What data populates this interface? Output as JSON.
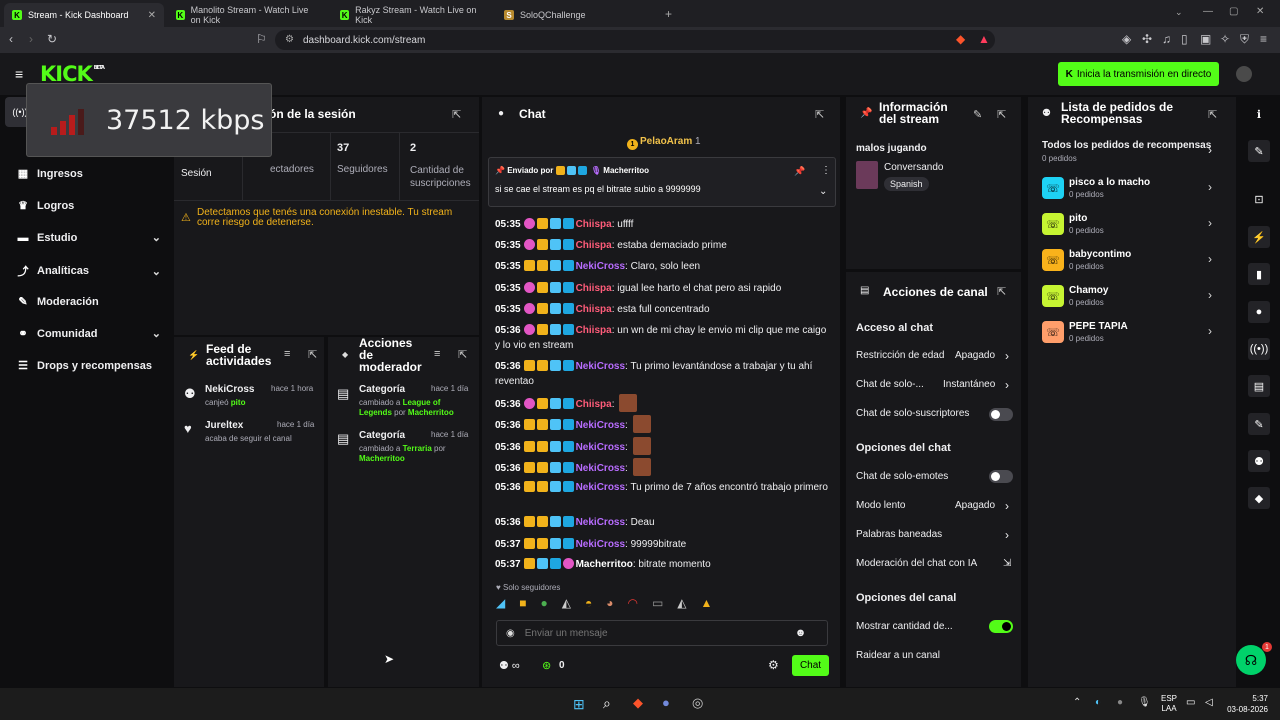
{
  "browser": {
    "tabs": [
      {
        "label": "Stream - Kick Dashboard",
        "active": true
      },
      {
        "label": "Manolito Stream - Watch Live on Kick",
        "active": false
      },
      {
        "label": "Rakyz Stream - Watch Live on Kick",
        "active": false
      },
      {
        "label": "SoloQChallenge",
        "active": false
      }
    ],
    "url": "dashboard.kick.com/stream"
  },
  "header": {
    "logo": "KICK",
    "logo_tag": "BETA",
    "go_live_label": "Inicia la transmisión en directo"
  },
  "overlay": {
    "kbps": "37512 kbps"
  },
  "sidebar": {
    "items": [
      {
        "label": "Ingresos",
        "icon": "dollar-icon",
        "chevron": false
      },
      {
        "label": "Logros",
        "icon": "trophy-icon",
        "chevron": false
      },
      {
        "label": "Estudio",
        "icon": "studio-icon",
        "chevron": true
      },
      {
        "label": "Analíticas",
        "icon": "chart-icon",
        "chevron": true
      },
      {
        "label": "Moderación",
        "icon": "wrench-icon",
        "chevron": false
      },
      {
        "label": "Comunidad",
        "icon": "community-icon",
        "chevron": true
      },
      {
        "label": "Drops y recompensas",
        "icon": "list-icon",
        "chevron": false
      }
    ]
  },
  "session": {
    "title": "ón de la sesión",
    "stats": [
      {
        "value": "",
        "label": "Sesión"
      },
      {
        "value": "",
        "label": "ectadores"
      },
      {
        "value": "37",
        "label": "Seguidores"
      },
      {
        "value": "2",
        "label": "Cantidad de suscripciones"
      }
    ],
    "warning": "Detectamos que tenés una conexión inestable. Tu stream corre riesgo de detenerse."
  },
  "activity_feed": {
    "title": "Feed de actividades",
    "items": [
      {
        "user": "NekiCross",
        "time": "hace 1 hora",
        "text_prefix": "canjeó ",
        "highlight": "pito"
      },
      {
        "user": "Jureltex",
        "time": "hace 1 día",
        "text_prefix": "acaba de seguir el canal",
        "highlight": ""
      }
    ]
  },
  "mod_actions": {
    "title": "Acciones de moderador",
    "items": [
      {
        "title": "Categoría",
        "time": "hace 1 día",
        "prefix": "cambiado a ",
        "value": "League of Legends",
        "by_label": " por ",
        "by": "Macherritoo"
      },
      {
        "title": "Categoría",
        "time": "hace 1 día",
        "prefix": "cambiado a ",
        "value": "Terraria",
        "by_label": " por ",
        "by": "Macherritoo"
      }
    ]
  },
  "chat": {
    "title": "Chat",
    "top_gifter": "PelaoAram",
    "top_gifter_count": "1",
    "pinned_by_label": "Enviado por",
    "pinned_by": "Macherritoo",
    "pinned_text": "si se cae el stream es pq el bitrate subio a 9999999",
    "messages": [
      {
        "time": "05:35",
        "user": "Chiispa",
        "color": "red",
        "text": "uffff"
      },
      {
        "time": "05:35",
        "user": "Chiispa",
        "color": "red",
        "text": "estaba demaciado prime"
      },
      {
        "time": "05:35",
        "user": "NekiCross",
        "color": "pur",
        "text": "Claro, solo leen"
      },
      {
        "time": "05:35",
        "user": "Chiispa",
        "color": "red",
        "text": "igual lee harto el chat pero asi rapido"
      },
      {
        "time": "05:35",
        "user": "Chiispa",
        "color": "red",
        "text": "esta full concentrado"
      },
      {
        "time": "05:36",
        "user": "Chiispa",
        "color": "red",
        "text": "un wn de mi chay le envio mi clip que me caigo y lo vio en stream"
      },
      {
        "time": "05:36",
        "user": "NekiCross",
        "color": "pur",
        "text": "Tu primo levantándose a trabajar y tu ahí reventao"
      },
      {
        "time": "05:36",
        "user": "Chiispa",
        "color": "red",
        "text": ""
      },
      {
        "time": "05:36",
        "user": "NekiCross",
        "color": "pur",
        "text": ""
      },
      {
        "time": "05:36",
        "user": "NekiCross",
        "color": "pur",
        "text": ""
      },
      {
        "time": "05:36",
        "user": "NekiCross",
        "color": "pur",
        "text": ""
      },
      {
        "time": "05:36",
        "user": "NekiCross",
        "color": "pur",
        "text": "Tu primo de 7 años encontró trabajo primero"
      },
      {
        "time": "05:36",
        "user": "NekiCross",
        "color": "pur",
        "text": "Deau"
      },
      {
        "time": "05:37",
        "user": "NekiCross",
        "color": "pur",
        "text": "99999bitrate"
      },
      {
        "time": "05:37",
        "user": "Macherritoo",
        "color": "wh",
        "text": "bitrate momento"
      }
    ],
    "followers_only": "Solo seguidores",
    "input_placeholder": "Enviar un mensaje",
    "points_value": "0",
    "send_label": "Chat"
  },
  "stream_info": {
    "title": "Información del stream",
    "stream_title": "malos jugando",
    "category": "Conversando",
    "language": "Spanish"
  },
  "channel_actions": {
    "title": "Acciones de canal",
    "chat_access_header": "Acceso al chat",
    "age_restriction": {
      "label": "Restricción de edad",
      "value": "Apagado"
    },
    "followers_only": {
      "label": "Chat de solo-...",
      "value": "Instantáneo"
    },
    "subs_only": {
      "label": "Chat de solo-suscriptores"
    },
    "chat_options_header": "Opciones del chat",
    "emotes_only": {
      "label": "Chat de solo-emotes"
    },
    "slow_mode": {
      "label": "Modo lento",
      "value": "Apagado"
    },
    "banned_words": {
      "label": "Palabras baneadas"
    },
    "ai_mod": {
      "label": "Moderación del chat con IA"
    },
    "channel_options_header": "Opciones del canal",
    "show_count": {
      "label": "Mostrar cantidad de..."
    },
    "raid": {
      "label": "Raidear a un canal"
    }
  },
  "rewards": {
    "title": "Lista de pedidos de Recompensas",
    "all_label": "Todos los pedidos de recompensas",
    "all_count": "0 pedidos",
    "items": [
      {
        "name": "pisco a lo macho",
        "count": "0 pedidos",
        "color": "#1ed2f4"
      },
      {
        "name": "pito",
        "count": "0 pedidos",
        "color": "#c6f432"
      },
      {
        "name": "babycontimo",
        "count": "0 pedidos",
        "color": "#f9b21b"
      },
      {
        "name": "Chamoy",
        "count": "0 pedidos",
        "color": "#c6f432"
      },
      {
        "name": "PEPE TAPIA",
        "count": "0 pedidos",
        "color": "#ff9e6b"
      }
    ]
  },
  "taskbar": {
    "lang": "ESP",
    "lang2": "LAA",
    "time": "5:37",
    "date": "03-08-2026",
    "notif_count": "1"
  }
}
